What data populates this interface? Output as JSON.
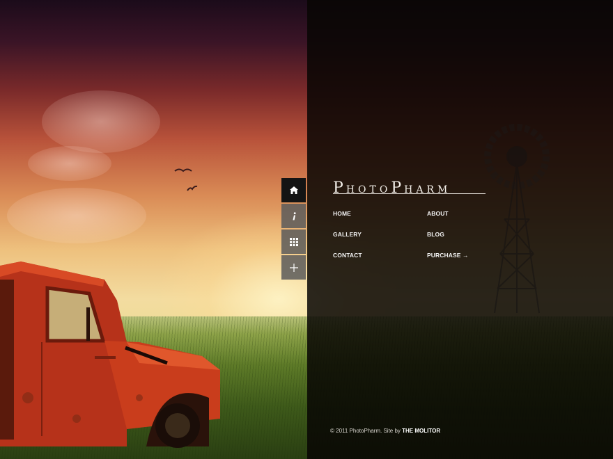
{
  "brand": {
    "logo_first_initial": "P",
    "logo_first_rest": "HOTO",
    "logo_second_initial": "P",
    "logo_second_rest": "HARM"
  },
  "side_tabs": [
    {
      "icon": "home-icon",
      "state": "active"
    },
    {
      "icon": "info-icon",
      "state": "inactive"
    },
    {
      "icon": "grid-icon",
      "state": "inactive"
    },
    {
      "icon": "plus-icon",
      "state": "inactive"
    }
  ],
  "nav": {
    "home": "HOME",
    "about": "ABOUT",
    "gallery": "GALLERY",
    "blog": "BLOG",
    "contact": "CONTACT",
    "purchase": "PURCHASE →"
  },
  "footer": {
    "copyright": "© 2011 PhotoPharm. Site by ",
    "credit": "THE MOLITOR"
  },
  "colors": {
    "panel_overlay": "#080604",
    "tab_active": "#141414",
    "tab_inactive": "#5a5a5a",
    "text": "#f2f2f2"
  }
}
